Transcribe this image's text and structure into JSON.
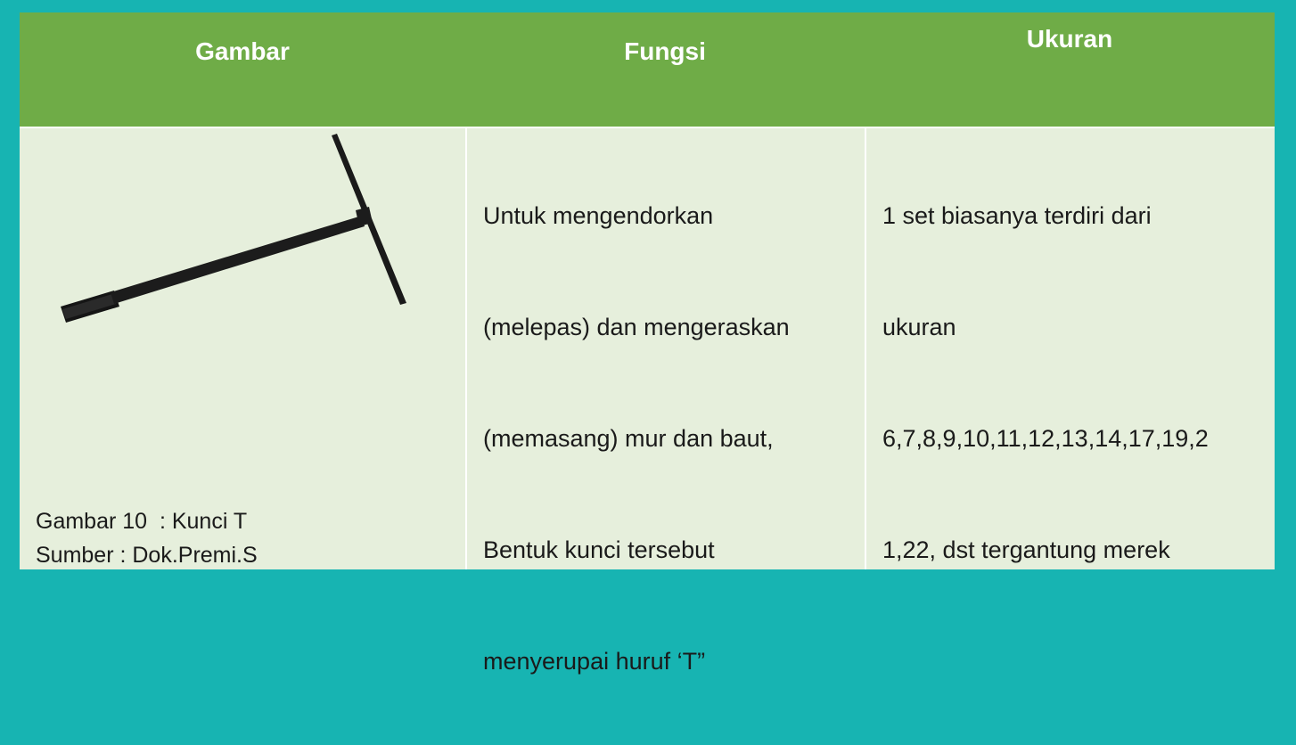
{
  "table": {
    "headers": {
      "gambar": "Gambar",
      "fungsi": "Fungsi",
      "ukuran": "Ukuran"
    },
    "row": {
      "image_caption_line1": "Gambar 10  : Kunci T",
      "image_caption_line2": "Sumber : Dok.Premi.S",
      "image_icon": "t-wrench-icon",
      "fungsi_lines": [
        "Untuk mengendorkan",
        "(melepas) dan mengeraskan",
        "(memasang) mur dan baut,",
        "Bentuk kunci tersebut",
        "menyerupai huruf ‘T”"
      ],
      "ukuran_lines": [
        "1 set biasanya terdiri dari",
        "ukuran",
        "6,7,8,9,10,11,12,13,14,17,19,2",
        "1,22, dst tergantung merek"
      ]
    }
  },
  "colors": {
    "frame": "#17b4b2",
    "header": "#6fac47",
    "cell": "#e6efdc"
  }
}
